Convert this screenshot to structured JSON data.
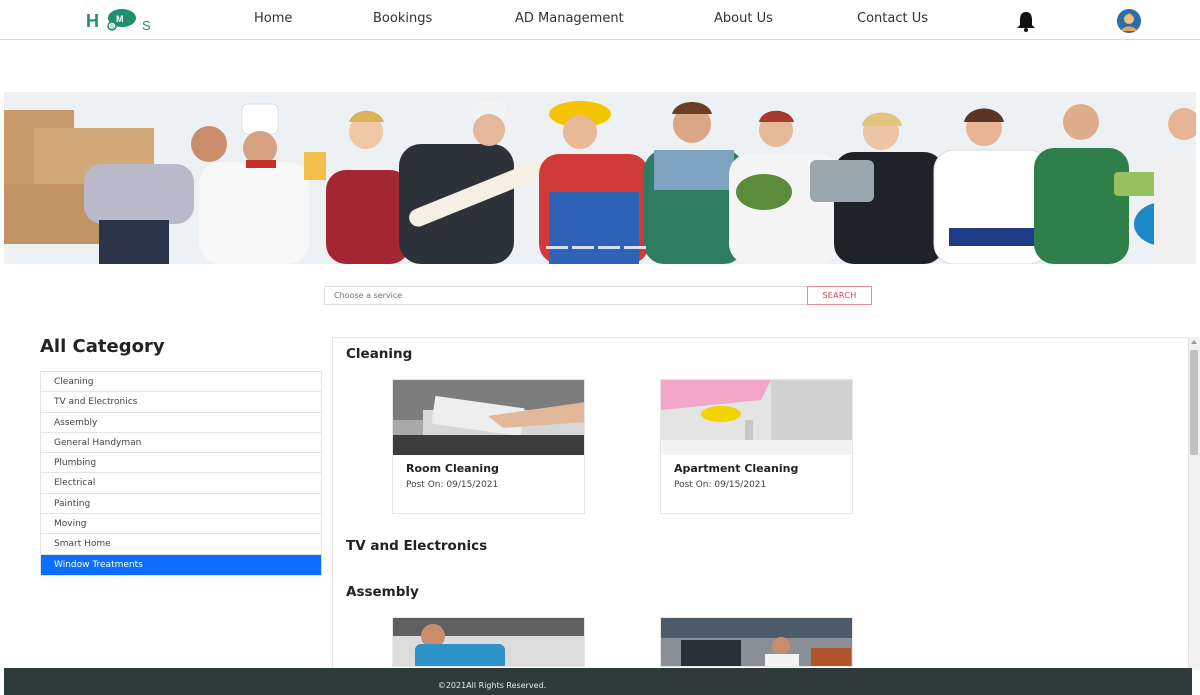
{
  "nav": {
    "logo_text": "HSMS",
    "links": [
      "Home",
      "Bookings",
      "AD Management",
      "About Us",
      "Contact Us"
    ]
  },
  "search": {
    "placeholder": "Choose a service",
    "button_label": "SEARCH"
  },
  "sidebar": {
    "title": "All Category",
    "items": [
      "Cleaning",
      "TV and Electronics",
      "Assembly",
      "General Handyman",
      "Plumbing",
      "Electrical",
      "Painting",
      "Moving",
      "Smart Home",
      "Window Treatments"
    ],
    "active_item": "Window Treatments"
  },
  "content": {
    "sections": [
      {
        "title": "Cleaning",
        "cards": [
          {
            "title": "Room Cleaning",
            "date": "Post On: 09/15/2021"
          },
          {
            "title": "Apartment Cleaning",
            "date": "Post On: 09/15/2021"
          }
        ]
      },
      {
        "title": "TV and Electronics",
        "cards": []
      },
      {
        "title": "Assembly",
        "cards": [
          {
            "title": "",
            "date": ""
          },
          {
            "title": "",
            "date": ""
          }
        ]
      }
    ]
  },
  "footer": {
    "text": "©2021All Rights Reserved."
  },
  "colors": {
    "brand": "#1f8f6f",
    "active": "#0d6efd",
    "search_btn": "#d6455a",
    "footer": "#2f3b3b"
  },
  "icons": {
    "notifications": "bell-icon",
    "profile": "avatar-icon"
  }
}
